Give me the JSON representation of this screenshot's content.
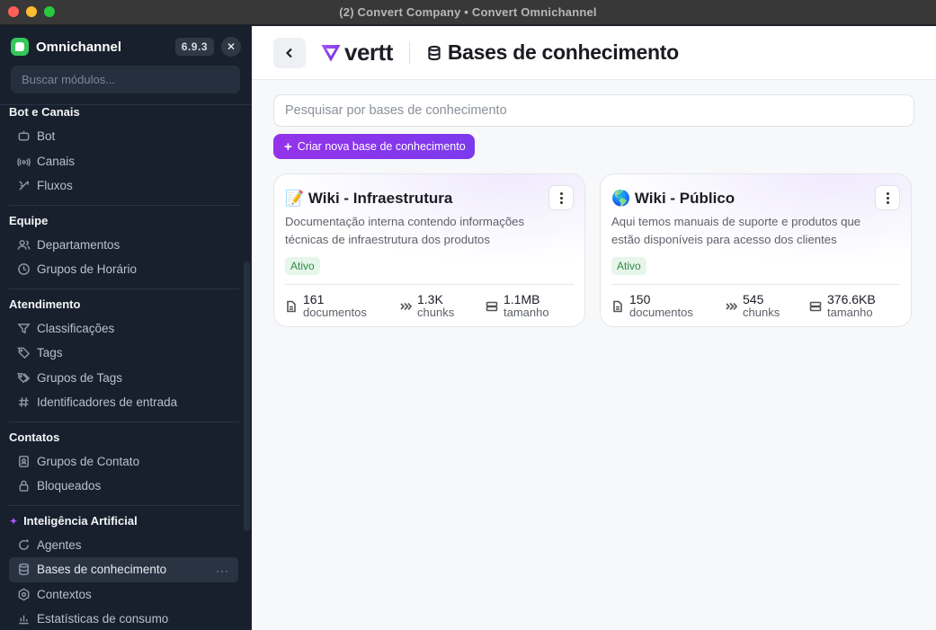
{
  "window": {
    "title": "(2) Convert Company • Convert Omnichannel"
  },
  "sidebar": {
    "brand": "Omnichannel",
    "version": "6.9.3",
    "close": "✕",
    "search_placeholder": "Buscar módulos...",
    "groups": [
      {
        "title": "Bot e Canais",
        "items": [
          {
            "label": "Bot",
            "icon": "bot-icon"
          },
          {
            "label": "Canais",
            "icon": "broadcast-icon"
          },
          {
            "label": "Fluxos",
            "icon": "flow-icon"
          }
        ]
      },
      {
        "title": "Equipe",
        "items": [
          {
            "label": "Departamentos",
            "icon": "users-icon"
          },
          {
            "label": "Grupos de Horário",
            "icon": "clock-icon"
          }
        ]
      },
      {
        "title": "Atendimento",
        "items": [
          {
            "label": "Classificações",
            "icon": "filter-icon"
          },
          {
            "label": "Tags",
            "icon": "tag-icon"
          },
          {
            "label": "Grupos de Tags",
            "icon": "tags-icon"
          },
          {
            "label": "Identificadores de entrada",
            "icon": "hash-icon"
          }
        ]
      },
      {
        "title": "Contatos",
        "items": [
          {
            "label": "Grupos de Contato",
            "icon": "contact-book-icon"
          },
          {
            "label": "Bloqueados",
            "icon": "lock-icon"
          }
        ]
      },
      {
        "title": "Inteligência Artificial",
        "items": [
          {
            "label": "Agentes",
            "icon": "agent-icon"
          },
          {
            "label": "Bases de conhecimento",
            "icon": "database-icon",
            "active": true
          },
          {
            "label": "Contextos",
            "icon": "hexagon-icon"
          },
          {
            "label": "Estatísticas de consumo",
            "icon": "chart-icon"
          }
        ]
      }
    ]
  },
  "header": {
    "logo_text": "vertt",
    "page_title": "Bases de conhecimento"
  },
  "main": {
    "search_placeholder": "Pesquisar por bases de conhecimento",
    "create_label": "Criar nova base de conhecimento",
    "cards": [
      {
        "title": "📝 Wiki - Infraestrutura",
        "description": "Documentação interna contendo informações técnicas de infraestrutura dos produtos",
        "status": "Ativo",
        "docs_value": "161",
        "docs_label": "documentos",
        "chunks_value": "1.3K",
        "chunks_label": "chunks",
        "size_value": "1.1MB",
        "size_label": "tamanho"
      },
      {
        "title": "🌎 Wiki - Público",
        "description": "Aqui temos manuais de suporte e produtos que estão disponíveis para acesso dos clientes",
        "status": "Ativo",
        "docs_value": "150",
        "docs_label": "documentos",
        "chunks_value": "545",
        "chunks_label": "chunks",
        "size_value": "376.6KB",
        "size_label": "tamanho"
      }
    ]
  }
}
